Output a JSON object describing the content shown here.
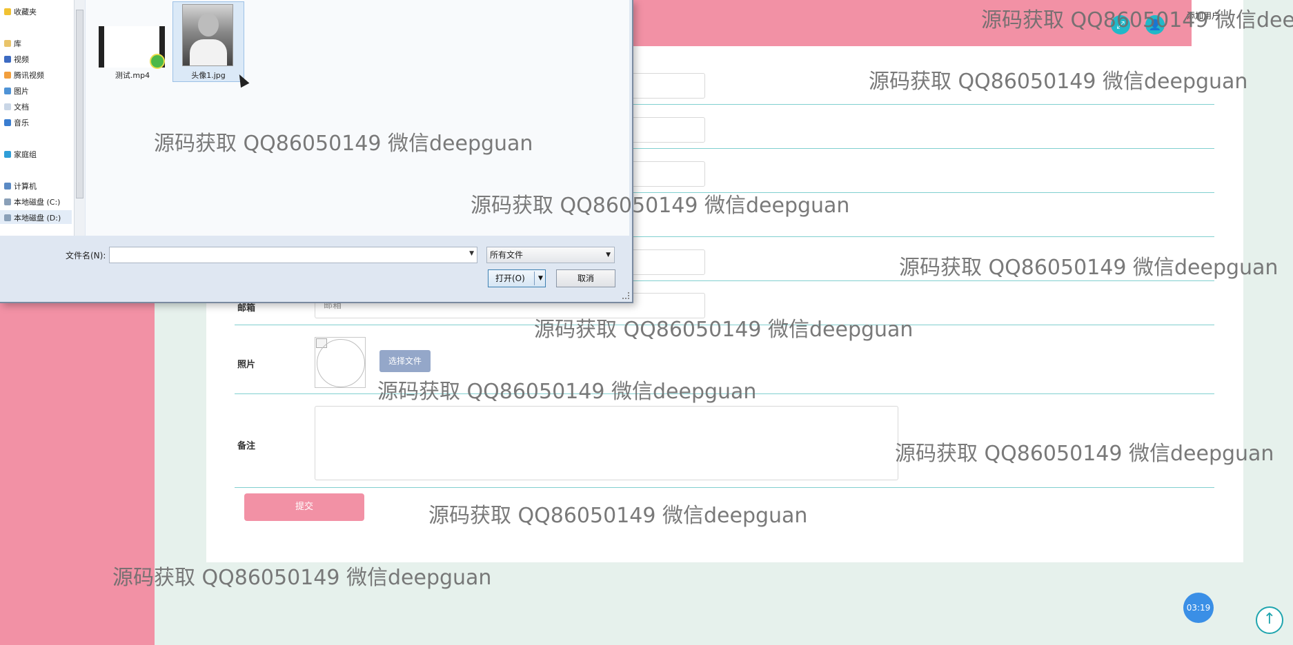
{
  "header": {
    "right_label": "添加用户",
    "expand_icon": "expand-icon",
    "user_icon": "user-icon"
  },
  "form": {
    "email_label": "邮箱",
    "email_placeholder": "邮箱",
    "photo_label": "照片",
    "choose_file_label": "选择文件",
    "note_label": "备注",
    "submit_label": "提交"
  },
  "dialog": {
    "nav": {
      "favorites": "收藏夹",
      "library": "库",
      "videos": "视频",
      "tencent_video": "腾讯视频",
      "pictures": "图片",
      "documents": "文档",
      "music": "音乐",
      "homegroup": "家庭组",
      "computer": "计算机",
      "disk_c": "本地磁盘 (C:)",
      "disk_d": "本地磁盘 (D:)"
    },
    "files": [
      {
        "name": "测试.mp4",
        "type": "video"
      },
      {
        "name": "头像1.jpg",
        "type": "image"
      }
    ],
    "filename_label": "文件名(N):",
    "filename_value": "",
    "filetype_value": "所有文件",
    "open_label": "打开(O)",
    "cancel_label": "取消"
  },
  "clock": "03:19",
  "watermark": "源码获取 QQ86050149 微信deepguan",
  "colors": {
    "accent_pink": "#f291a5",
    "accent_teal": "#21b8c8",
    "page_bg": "#e6f1ec"
  }
}
